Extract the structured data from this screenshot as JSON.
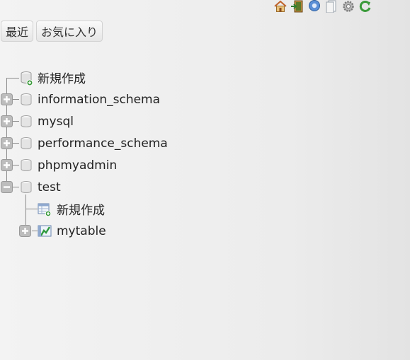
{
  "header": {
    "icons": [
      "home-icon",
      "logout-icon",
      "help-icon",
      "docs-icon",
      "settings-icon",
      "reload-icon"
    ]
  },
  "tabs": [
    {
      "label": "最近"
    },
    {
      "label": "お気に入り"
    }
  ],
  "tree": {
    "new_db_label": "新規作成",
    "databases": [
      {
        "name": "information_schema",
        "state": "collapsed"
      },
      {
        "name": "mysql",
        "state": "collapsed"
      },
      {
        "name": "performance_schema",
        "state": "collapsed"
      },
      {
        "name": "phpmyadmin",
        "state": "collapsed"
      },
      {
        "name": "test",
        "state": "expanded"
      }
    ],
    "test_children": {
      "new_table_label": "新規作成",
      "tables": [
        {
          "name": "mytable",
          "state": "collapsed"
        }
      ]
    }
  },
  "colors": {
    "background": "#ececec",
    "tree_line": "#8a8a8a",
    "toggle_fill": "#b9b9b9"
  }
}
